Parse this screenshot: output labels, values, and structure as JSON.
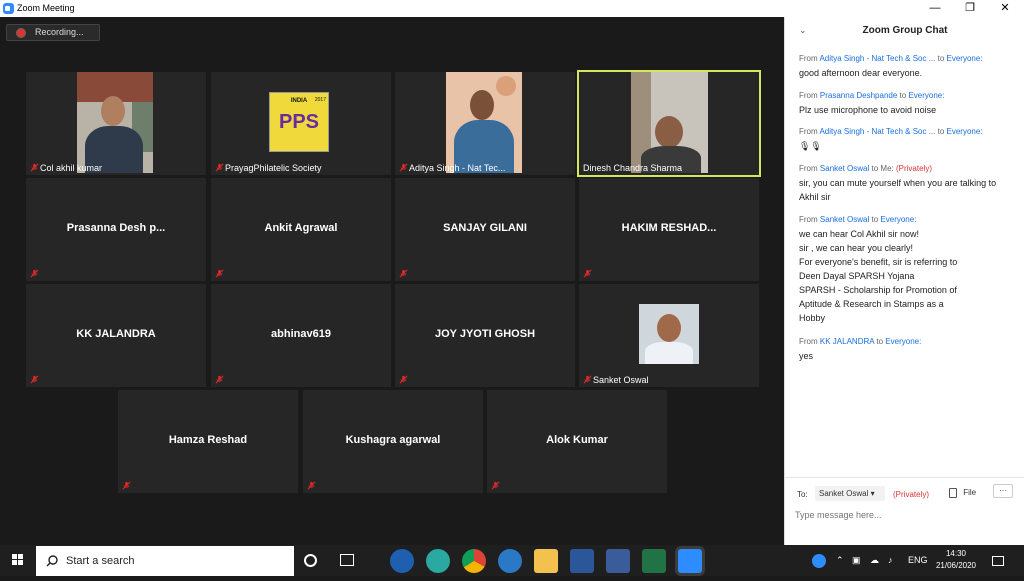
{
  "window": {
    "title": "Zoom Meeting"
  },
  "recording": {
    "label": "Recording..."
  },
  "tiles": [
    {
      "name": "",
      "label": "Col akhil kumar"
    },
    {
      "name": "",
      "label": "PrayagPhilatelic Society",
      "logo_top": "INDIA",
      "logo_text": "PPS",
      "logo_year": "2017"
    },
    {
      "name": "",
      "label": "Aditya Singh - Nat Tec..."
    },
    {
      "name": "",
      "label": "Dinesh Chandra Sharma"
    },
    {
      "name": "Prasanna  Desh p...",
      "label": ""
    },
    {
      "name": "Ankit Agrawal",
      "label": ""
    },
    {
      "name": "SANJAY GILANI",
      "label": ""
    },
    {
      "name": "HAKIM  RESHAD...",
      "label": ""
    },
    {
      "name": "KK JALANDRA",
      "label": ""
    },
    {
      "name": "abhinav619",
      "label": ""
    },
    {
      "name": "JOY JYOTI GHOSH",
      "label": ""
    },
    {
      "name": "",
      "label": "Sanket Oswal"
    },
    {
      "name": "Hamza Reshad",
      "label": ""
    },
    {
      "name": "Kushagra agarwal",
      "label": ""
    },
    {
      "name": "Alok Kumar",
      "label": ""
    }
  ],
  "chat": {
    "title": "Zoom Group Chat",
    "from_word": "From",
    "to_word": "to",
    "messages": [
      {
        "from": "Aditya Singh - Nat Tech & Soc ...",
        "to": "Everyone:",
        "text": "good afternoon dear everyone."
      },
      {
        "from": "Prasanna Deshpande",
        "to": "Everyone:",
        "text": "Plz use microphone to avoid noise"
      },
      {
        "from": "Aditya Singh - Nat Tech & Soc ...",
        "to": "Everyone:",
        "text": "🎙🎙"
      },
      {
        "from": "Sanket Oswal",
        "to": "Me:",
        "private": "(Privately)",
        "text": "sir, you can mute yourself when you are talking to Akhil sir"
      },
      {
        "from": "Sanket Oswal",
        "to": "Everyone:",
        "lines": [
          "we can hear Col Akhil sir now!",
          "sir , we can hear you clearly!",
          "For everyone's benefit, sir is referring to",
          "Deen Dayal SPARSH Yojana",
          "SPARSH - Scholarship for Promotion of",
          "Aptitude & Research in Stamps as a",
          "Hobby"
        ]
      },
      {
        "from": "KK JALANDRA",
        "to": "Everyone:",
        "text": "yes"
      }
    ],
    "composer": {
      "to_label": "To:",
      "recipient": "Sanket Oswal",
      "private": "(Privately)",
      "file_label": "File",
      "more": "···",
      "placeholder": "Type message here..."
    }
  },
  "taskbar": {
    "search_placeholder": "Start a search",
    "lang": "ENG",
    "time": "14:30",
    "date": "21/06/2020"
  },
  "colors": {
    "active_border": "#d3e65c",
    "mute_red": "#e02828",
    "zoom_blue": "#2d8cff",
    "link_blue": "#1a6fe0"
  }
}
